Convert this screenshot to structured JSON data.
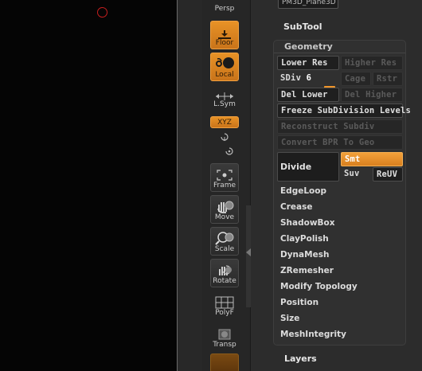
{
  "toolbar": {
    "persp_label": "Persp",
    "floor_label": "Floor",
    "local_label": "Local",
    "lsym_label": "L.Sym",
    "xyz_label": "XYZ",
    "frame_label": "Frame",
    "move_label": "Move",
    "scale_label": "Scale",
    "rotate_label": "Rotate",
    "polyf_label": "PolyF",
    "transp_label": "Transp"
  },
  "panel": {
    "tool_name": "PM3D_Plane3D",
    "subtool_title": "SubTool",
    "geometry_title": "Geometry",
    "lower_res": "Lower Res",
    "higher_res": "Higher Res",
    "sdiv_label": "SDiv",
    "sdiv_value": "6",
    "sdiv_level": 1.0,
    "cage": "Cage",
    "rstr": "Rstr",
    "del_lower": "Del Lower",
    "del_higher": "Del Higher",
    "freeze": "Freeze SubDivision Levels",
    "reconstruct": "Reconstruct Subdiv",
    "convert_bpr": "Convert BPR To Geo",
    "divide": "Divide",
    "smt": "Smt",
    "suv": "Suv",
    "reuv": "ReUV",
    "subpalettes": [
      "EdgeLoop",
      "Crease",
      "ShadowBox",
      "ClayPolish",
      "DynaMesh",
      "ZRemesher",
      "Modify Topology",
      "Position",
      "Size",
      "MeshIntegrity"
    ],
    "layers_title": "Layers"
  },
  "colors": {
    "accent": "#e8902a",
    "canvas": "#050505",
    "panel": "#2c2c2c",
    "cursor": "#c41e1e"
  }
}
